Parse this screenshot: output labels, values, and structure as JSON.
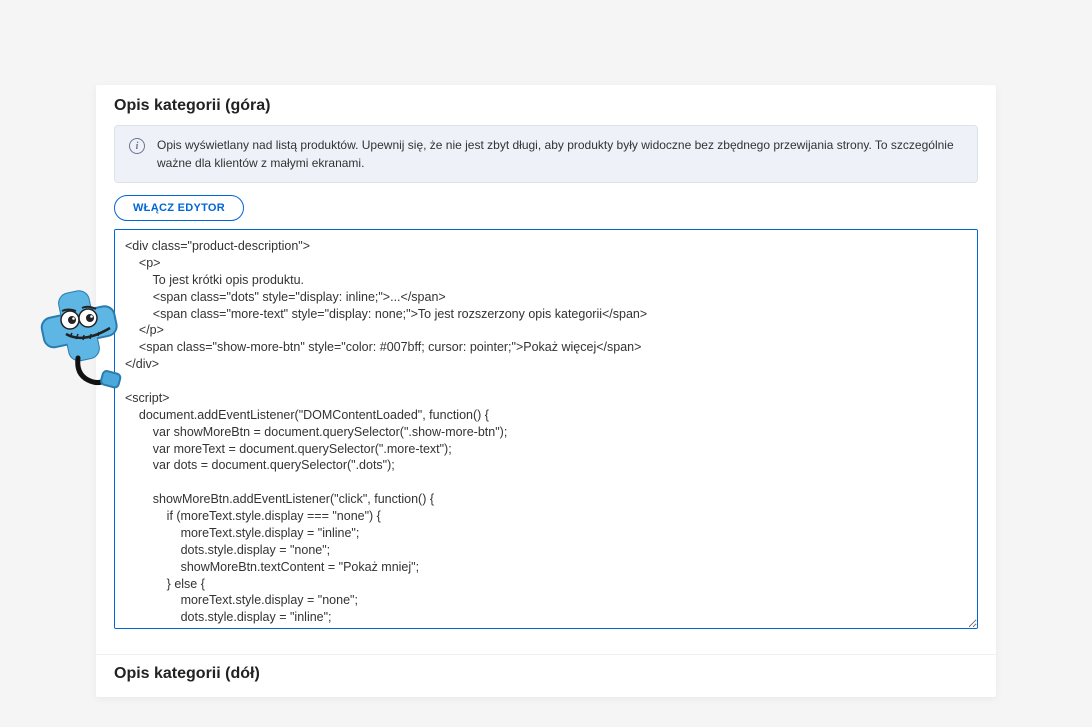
{
  "section_top_title": "Opis kategorii (góra)",
  "info_text": "Opis wyświetlany nad listą produktów. Upewnij się, że nie jest zbyt długi, aby produkty były widoczne bez zbędnego przewijania strony. To szczególnie ważne dla klientów z małymi ekranami.",
  "editor_button_label": "WŁĄCZ EDYTOR",
  "code_content": "<div class=\"product-description\">\n    <p>\n        To jest krótki opis produktu.\n        <span class=\"dots\" style=\"display: inline;\">...</span>\n        <span class=\"more-text\" style=\"display: none;\">To jest rozszerzony opis kategorii</span>\n    </p>\n    <span class=\"show-more-btn\" style=\"color: #007bff; cursor: pointer;\">Pokaż więcej</span>\n</div>\n\n<script>\n    document.addEventListener(\"DOMContentLoaded\", function() {\n        var showMoreBtn = document.querySelector(\".show-more-btn\");\n        var moreText = document.querySelector(\".more-text\");\n        var dots = document.querySelector(\".dots\");\n\n        showMoreBtn.addEventListener(\"click\", function() {\n            if (moreText.style.display === \"none\") {\n                moreText.style.display = \"inline\";\n                dots.style.display = \"none\";\n                showMoreBtn.textContent = \"Pokaż mniej\";\n            } else {\n                moreText.style.display = \"none\";\n                dots.style.display = \"inline\";\n                showMoreBtn.textContent = \"Pokaż więcej\";\n            }\n        });\n    });\n</script>",
  "section_bottom_title": "Opis kategorii (dół)"
}
